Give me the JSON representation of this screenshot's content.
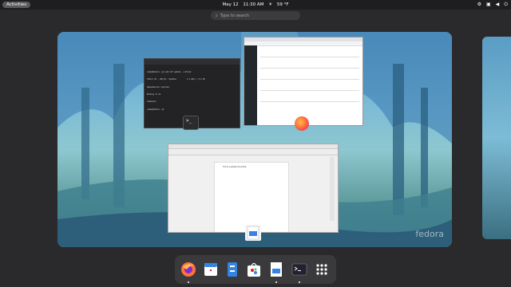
{
  "topbar": {
    "activities_label": "Activities",
    "date": "May 12",
    "time": "11:30 AM",
    "weather_temp": "59 °F"
  },
  "search": {
    "placeholder": "Type to search"
  },
  "workspace": {
    "watermark": "fedora",
    "windows": [
      {
        "app": "Terminal"
      },
      {
        "app": "Firefox"
      },
      {
        "app": "LibreOffice Writer"
      }
    ],
    "terminal_lines": [
      "[demo@fedora ~]$ sudo dnf update --refresh",
      "Fedora 36 - x86_64 - Updates          5.1 kB/s | 9.2 kB",
      "Dependencies resolved.",
      "Nothing to do.",
      "Complete!",
      "[demo@fedora ~]$"
    ],
    "writer_text": "This is a sample document."
  },
  "dock": {
    "items": [
      {
        "name": "Firefox",
        "icon": "firefox-icon",
        "running": true
      },
      {
        "name": "Calendar",
        "icon": "calendar-icon",
        "running": false
      },
      {
        "name": "Files",
        "icon": "files-icon",
        "running": false
      },
      {
        "name": "Software",
        "icon": "software-icon",
        "running": false
      },
      {
        "name": "LibreOffice Writer",
        "icon": "writer-icon",
        "running": true
      },
      {
        "name": "Terminal",
        "icon": "terminal-icon",
        "running": true
      },
      {
        "name": "Show Applications",
        "icon": "app-grid-icon",
        "running": false
      }
    ]
  },
  "colors": {
    "accent": "#3584e4",
    "panel": "#1e1e20"
  }
}
